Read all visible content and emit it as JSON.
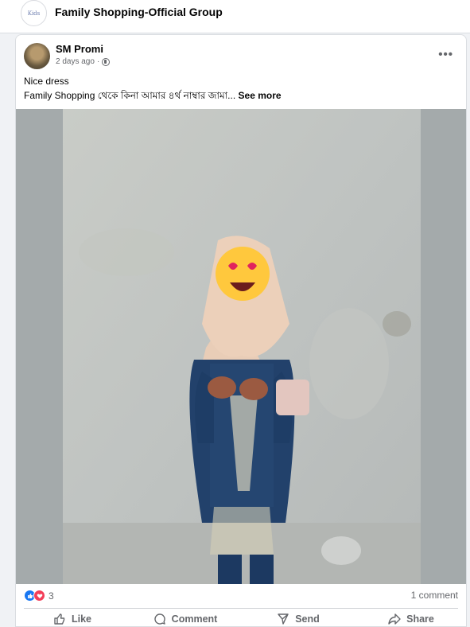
{
  "group": {
    "logo_text": "Kids",
    "name": "Family Shopping-Official Group"
  },
  "post": {
    "author": "SM Promi",
    "time": "2 days ago",
    "more_icon": "more-options-icon",
    "caption_line1": "Nice dress",
    "caption_line2": "Family Shopping থেকে কিনা আমার ৪র্থ নাম্বার জামা...",
    "see_more": "See more",
    "reaction_count": "3",
    "comment_count": "1 comment"
  },
  "actions": {
    "like": "Like",
    "comment": "Comment",
    "send": "Send",
    "share": "Share"
  },
  "colors": {
    "accent": "#1877f2",
    "love": "#f33e58",
    "secondary_text": "#65676b"
  }
}
